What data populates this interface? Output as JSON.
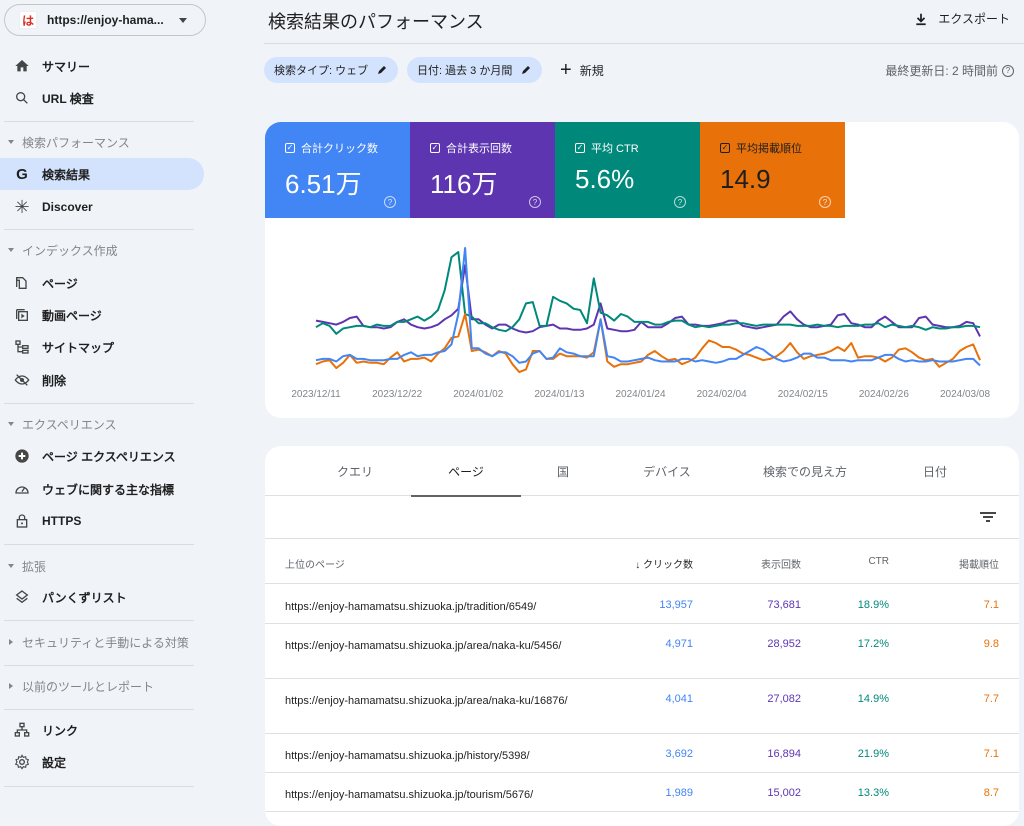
{
  "colors": {
    "clicks": "#4285f4",
    "impressions": "#5e35b1",
    "ctr": "#00897b",
    "position": "#e8710a",
    "active_nav_bg": "#d3e3fd"
  },
  "sidebar": {
    "property_url": "https://enjoy-hama...",
    "property_favicon": "は",
    "top_items": [
      {
        "label": "サマリー",
        "icon": "home-icon"
      },
      {
        "label": "URL 検査",
        "icon": "search-icon"
      }
    ],
    "sections": [
      {
        "title": "検索パフォーマンス",
        "expanded": true,
        "items": [
          {
            "label": "検索結果",
            "icon": "google-g-icon",
            "active": true
          },
          {
            "label": "Discover",
            "icon": "asterisk-icon"
          }
        ]
      },
      {
        "title": "インデックス作成",
        "expanded": true,
        "items": [
          {
            "label": "ページ",
            "icon": "pages-icon"
          },
          {
            "label": "動画ページ",
            "icon": "video-pages-icon"
          },
          {
            "label": "サイトマップ",
            "icon": "sitemap-icon"
          },
          {
            "label": "削除",
            "icon": "visibility-off-icon"
          }
        ]
      },
      {
        "title": "エクスペリエンス",
        "expanded": true,
        "items": [
          {
            "label": "ページ エクスペリエンス",
            "icon": "add-circle-icon"
          },
          {
            "label": "ウェブに関する主な指標",
            "icon": "speedometer-icon"
          },
          {
            "label": "HTTPS",
            "icon": "lock-icon"
          }
        ]
      },
      {
        "title": "拡張",
        "expanded": true,
        "items": [
          {
            "label": "パンくずリスト",
            "icon": "layers-icon"
          }
        ]
      },
      {
        "title": "セキュリティと手動による対策",
        "expanded": false,
        "items": []
      },
      {
        "title": "以前のツールとレポート",
        "expanded": false,
        "items": []
      }
    ],
    "bottom_items": [
      {
        "label": "リンク",
        "icon": "links-icon"
      },
      {
        "label": "設定",
        "icon": "gear-icon"
      }
    ]
  },
  "header": {
    "title": "検索結果のパフォーマンス",
    "export_label": "エクスポート",
    "filters": [
      {
        "label": "検索タイプ: ウェブ"
      },
      {
        "label": "日付: 過去 3 か月間"
      }
    ],
    "new_label": "新規",
    "last_updated": "最終更新日: 2 時間前"
  },
  "metrics": [
    {
      "label": "合計クリック数",
      "value": "6.51万",
      "checked": true,
      "color": "#4285f4"
    },
    {
      "label": "合計表示回数",
      "value": "116万",
      "checked": true,
      "color": "#5e35b1"
    },
    {
      "label": "平均 CTR",
      "value": "5.6%",
      "checked": true,
      "color": "#00897b"
    },
    {
      "label": "平均掲載順位",
      "value": "14.9",
      "checked": true,
      "color": "#e8710a"
    }
  ],
  "chart_data": {
    "type": "line",
    "title": "",
    "xlabel": "",
    "ylabel": "",
    "x_start": "2023/12/11",
    "x_tick_labels": [
      "2023/12/11",
      "2023/12/22",
      "2024/01/02",
      "2024/01/13",
      "2024/01/24",
      "2024/02/04",
      "2024/02/15",
      "2024/02/26",
      "2024/03/08"
    ],
    "grid": false,
    "legend": "none",
    "y_scale": "relative (0-100, each series independently scaled, no y-axis shown)",
    "series": [
      {
        "name": "合計クリック数",
        "color": "#4285f4",
        "values": [
          15,
          16,
          16,
          14,
          18,
          19,
          16,
          16,
          15,
          15,
          15,
          16,
          16,
          19,
          21,
          18,
          19,
          19,
          21,
          22,
          27,
          50,
          100,
          24,
          24,
          20,
          18,
          21,
          21,
          18,
          13,
          14,
          20,
          22,
          16,
          17,
          24,
          21,
          20,
          18,
          18,
          18,
          46,
          18,
          17,
          14,
          14,
          15,
          16,
          17,
          15,
          14,
          14,
          14,
          16,
          16,
          14,
          15,
          14,
          13,
          14,
          16,
          16,
          19,
          22,
          25,
          23,
          19,
          16,
          14,
          15,
          17,
          20,
          20,
          17,
          17,
          15,
          15,
          15,
          14,
          15,
          15,
          15,
          17,
          19,
          19,
          16,
          14,
          15,
          14,
          14,
          15,
          14,
          14,
          14,
          15,
          16,
          16,
          11
        ]
      },
      {
        "name": "合計表示回数",
        "color": "#5e35b1",
        "values": [
          45,
          44,
          43,
          42,
          44,
          47,
          48,
          41,
          40,
          40,
          39,
          40,
          44,
          46,
          42,
          40,
          39,
          40,
          42,
          46,
          49,
          54,
          87,
          46,
          46,
          42,
          39,
          42,
          42,
          39,
          37,
          36,
          37,
          40,
          41,
          42,
          39,
          39,
          38,
          38,
          39,
          42,
          58,
          39,
          38,
          37,
          37,
          38,
          44,
          40,
          40,
          40,
          43,
          47,
          48,
          42,
          42,
          41,
          41,
          42,
          43,
          45,
          45,
          41,
          40,
          39,
          40,
          41,
          42,
          48,
          52,
          46,
          42,
          40,
          40,
          41,
          42,
          49,
          50,
          43,
          42,
          40,
          40,
          45,
          48,
          44,
          40,
          40,
          40,
          47,
          48,
          42,
          41,
          40,
          40,
          41,
          44,
          43,
          33
        ]
      },
      {
        "name": "平均 CTR",
        "color": "#00897b",
        "values": [
          40,
          43,
          41,
          35,
          39,
          40,
          41,
          41,
          40,
          42,
          41,
          41,
          44,
          44,
          46,
          48,
          45,
          48,
          53,
          68,
          93,
          97,
          50,
          48,
          43,
          43,
          40,
          38,
          37,
          40,
          46,
          58,
          59,
          41,
          41,
          63,
          60,
          58,
          54,
          53,
          43,
          77,
          51,
          49,
          45,
          50,
          48,
          44,
          44,
          44,
          42,
          42,
          44,
          45,
          45,
          42,
          40,
          41,
          40,
          41,
          42,
          42,
          43,
          43,
          42,
          41,
          42,
          42,
          42,
          42,
          42,
          41,
          41,
          41,
          42,
          41,
          41,
          40,
          41,
          41,
          41,
          42,
          42,
          43,
          40,
          42,
          41,
          40,
          41,
          40,
          38,
          40,
          39,
          39,
          40,
          40,
          41,
          41,
          40
        ]
      },
      {
        "name": "平均掲載順位",
        "color": "#e8710a",
        "values": [
          12,
          14,
          15,
          9,
          13,
          19,
          13,
          14,
          13,
          13,
          12,
          17,
          21,
          14,
          16,
          16,
          17,
          14,
          20,
          24,
          32,
          33,
          50,
          22,
          23,
          21,
          18,
          22,
          20,
          12,
          6,
          8,
          22,
          22,
          16,
          16,
          20,
          18,
          18,
          18,
          17,
          21,
          46,
          14,
          10,
          12,
          12,
          13,
          14,
          19,
          22,
          18,
          15,
          16,
          12,
          14,
          17,
          24,
          30,
          28,
          25,
          25,
          23,
          20,
          19,
          17,
          15,
          16,
          18,
          22,
          28,
          21,
          16,
          18,
          19,
          20,
          22,
          25,
          22,
          28,
          17,
          18,
          18,
          17,
          14,
          17,
          23,
          24,
          21,
          17,
          15,
          16,
          10,
          13,
          16,
          22,
          25,
          27,
          15
        ]
      }
    ]
  },
  "table": {
    "tabs": [
      {
        "label": "クエリ",
        "active": false
      },
      {
        "label": "ページ",
        "active": true
      },
      {
        "label": "国",
        "active": false
      },
      {
        "label": "デバイス",
        "active": false
      },
      {
        "label": "検索での見え方",
        "active": false
      },
      {
        "label": "日付",
        "active": false
      }
    ],
    "columns": {
      "page": "上位のページ",
      "clicks": "クリック数",
      "impressions": "表示回数",
      "ctr": "CTR",
      "position": "掲載順位"
    },
    "sort_indicator": "↓",
    "rows": [
      {
        "url": "https://enjoy-hamamatsu.shizuoka.jp/tradition/6549/",
        "clicks": "13,957",
        "impressions": "73,681",
        "ctr": "18.9%",
        "position": "7.1"
      },
      {
        "url": "https://enjoy-hamamatsu.shizuoka.jp/area/naka-ku/5456/",
        "clicks": "4,971",
        "impressions": "28,952",
        "ctr": "17.2%",
        "position": "9.8"
      },
      {
        "url": "https://enjoy-hamamatsu.shizuoka.jp/area/naka-ku/16876/",
        "clicks": "4,041",
        "impressions": "27,082",
        "ctr": "14.9%",
        "position": "7.7"
      },
      {
        "url": "https://enjoy-hamamatsu.shizuoka.jp/history/5398/",
        "clicks": "3,692",
        "impressions": "16,894",
        "ctr": "21.9%",
        "position": "7.1"
      },
      {
        "url": "https://enjoy-hamamatsu.shizuoka.jp/tourism/5676/",
        "clicks": "1,989",
        "impressions": "15,002",
        "ctr": "13.3%",
        "position": "8.7"
      }
    ]
  }
}
